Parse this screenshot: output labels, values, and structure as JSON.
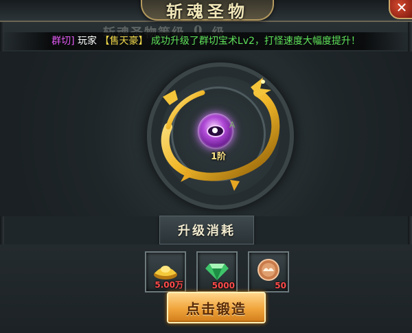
{
  "window": {
    "title": "斩魂圣物",
    "close_label": "✕"
  },
  "broadcast": {
    "channel": "群切]",
    "player_word": "玩家",
    "player_name": "【售天豪】",
    "action": "成功升级了群切宝术Lv2，打怪速度大幅度提升！"
  },
  "level_line": {
    "label": "斩魂圣物等级",
    "value": "0",
    "unit": "级"
  },
  "relic": {
    "tier_label": "1阶",
    "side_mark": "A"
  },
  "cost": {
    "header": "升级消耗",
    "items": [
      {
        "icon": "gold-ingot-icon",
        "amount": "5.00万"
      },
      {
        "icon": "green-gem-icon",
        "amount": "5000"
      },
      {
        "icon": "cloud-coin-icon",
        "amount": "50"
      }
    ]
  },
  "forge_button": {
    "label": "点击锻造"
  },
  "colors": {
    "accent_gold": "#f0a43b",
    "broadcast_green": "#5fe35a",
    "broadcast_purple": "#e15af2",
    "count_red": "#ff4c4c"
  }
}
